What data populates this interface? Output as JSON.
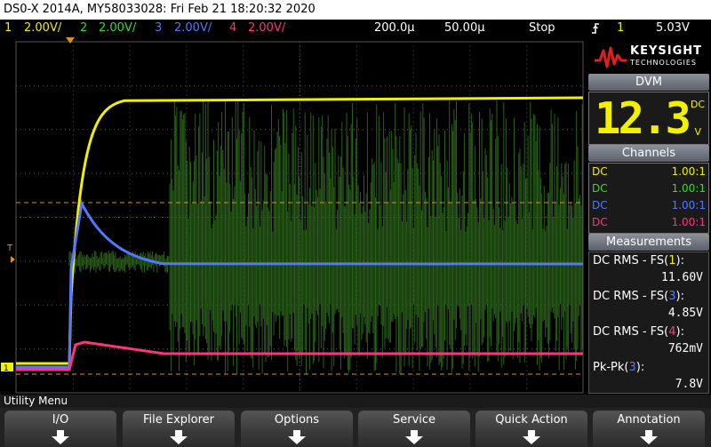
{
  "titlebar": {
    "text": "DS0-X 2014A, MY58033028: Fri Feb 21 18:20:32 2020"
  },
  "channels": [
    {
      "num": "1",
      "scale": "2.00V/",
      "color": "#f0f000"
    },
    {
      "num": "2",
      "scale": "2.00V/",
      "color": "#33dd33"
    },
    {
      "num": "3",
      "scale": "2.00V/",
      "color": "#5577ff"
    },
    {
      "num": "4",
      "scale": "2.00V/",
      "color": "#ff3380"
    }
  ],
  "timebase": {
    "time_per_div": "200.0µ",
    "delay": "50.00µ",
    "run_state": "Stop",
    "trigger_icon": "trigger-edge-icon",
    "trigger_source": "1",
    "trigger_level": "5.03V"
  },
  "brand": {
    "name": "KEYSIGHT",
    "sub": "TECHNOLOGIES",
    "logo_color": "#e0201f"
  },
  "dvm": {
    "title": "DVM",
    "value": "12.3",
    "mode": "DC",
    "unit": "V",
    "color": "#f0f000"
  },
  "channels_panel": {
    "title": "Channels",
    "rows": [
      {
        "coupling": "DC",
        "probe": "1.00:1",
        "color": "#f0f000"
      },
      {
        "coupling": "DC",
        "probe": "1.00:1",
        "color": "#33dd33"
      },
      {
        "coupling": "DC",
        "probe": "1.00:1",
        "color": "#5577ff"
      },
      {
        "coupling": "DC",
        "probe": "1.00:1",
        "color": "#ff3380"
      }
    ]
  },
  "measurements": {
    "title": "Measurements",
    "items": [
      {
        "prefix": "DC RMS - FS(",
        "ch": "1",
        "suffix": "):",
        "value": "11.60V",
        "color": "#f0f000"
      },
      {
        "prefix": "DC RMS - FS(",
        "ch": "3",
        "suffix": "):",
        "value": "4.85V",
        "color": "#5577ff"
      },
      {
        "prefix": "DC RMS - FS(",
        "ch": "4",
        "suffix": "):",
        "value": "762mV",
        "color": "#ff3380"
      },
      {
        "prefix": "Pk-Pk(",
        "ch": "3",
        "suffix": "):",
        "value": "7.8V",
        "color": "#5577ff"
      }
    ]
  },
  "grid_markers": {
    "trigger_marker": "T",
    "ground_marker": "1"
  },
  "utility_menu": {
    "label": "Utility Menu"
  },
  "softkeys": [
    {
      "label": "I/O"
    },
    {
      "label": "File Explorer"
    },
    {
      "label": "Options"
    },
    {
      "label": "Service"
    },
    {
      "label": "Quick Action"
    },
    {
      "label": "Annotation"
    }
  ]
}
